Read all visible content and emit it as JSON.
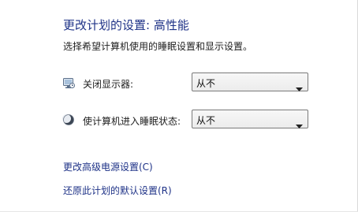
{
  "header": {
    "title": "更改计划的设置: 高性能",
    "subtitle": "选择希望计算机使用的睡眠设置和显示设置。"
  },
  "settings": {
    "display": {
      "label": "关闭显示器:",
      "value": "从不",
      "icon": "monitor-icon"
    },
    "sleep": {
      "label": "使计算机进入睡眠状态:",
      "value": "从不",
      "icon": "moon-icon"
    }
  },
  "links": {
    "advanced": "更改高级电源设置(C)",
    "restore": "还原此计划的默认设置(R)"
  },
  "colors": {
    "title": "#1e3287",
    "link": "#1e3287",
    "text": "#1e1e1e"
  }
}
